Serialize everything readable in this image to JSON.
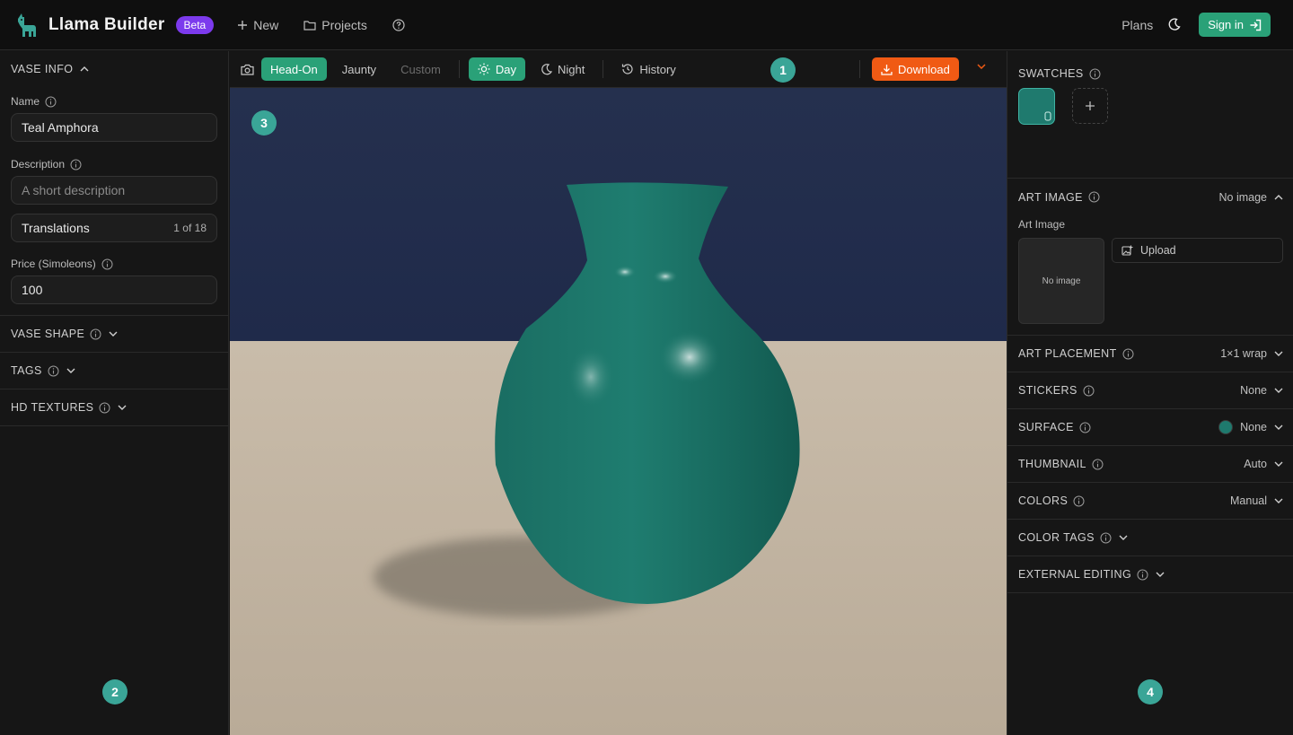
{
  "app": {
    "title": "Llama Builder",
    "badge": "Beta"
  },
  "nav": {
    "new": "New",
    "projects": "Projects"
  },
  "header": {
    "plans": "Plans",
    "signin": "Sign in"
  },
  "left": {
    "vase_info": "VASE INFO",
    "name_label": "Name",
    "name_value": "Teal Amphora",
    "description_label": "Description",
    "description_placeholder": "A short description",
    "translations_label": "Translations",
    "translations_count": "1 of 18",
    "price_label": "Price (Simoleons)",
    "price_value": "100",
    "sections": [
      "VASE SHAPE",
      "TAGS",
      "HD TEXTURES"
    ]
  },
  "toolbar": {
    "camera_views": [
      "Head-On",
      "Jaunty",
      "Custom"
    ],
    "lighting": [
      "Day",
      "Night"
    ],
    "history": "History",
    "download": "Download"
  },
  "right": {
    "swatches": "SWATCHES",
    "art_image": {
      "title": "ART IMAGE",
      "value": "No image",
      "sub_label": "Art Image",
      "placeholder": "No image",
      "upload": "Upload"
    },
    "rows": [
      {
        "label": "ART PLACEMENT",
        "value": "1×1 wrap"
      },
      {
        "label": "STICKERS",
        "value": "None"
      },
      {
        "label": "SURFACE",
        "value": "None"
      },
      {
        "label": "THUMBNAIL",
        "value": "Auto"
      },
      {
        "label": "COLORS",
        "value": "Manual"
      },
      {
        "label": "COLOR TAGS",
        "value": ""
      },
      {
        "label": "EXTERNAL EDITING",
        "value": ""
      }
    ]
  },
  "markers": [
    "1",
    "2",
    "3",
    "4"
  ],
  "colors": {
    "accent": "#2aa178",
    "download": "#f05a14",
    "beta": "#7c3aed",
    "vase": "#1f7a6e",
    "marker": "#3aa597"
  }
}
